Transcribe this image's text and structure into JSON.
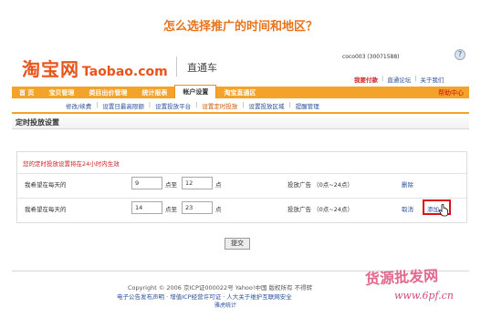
{
  "headline": "怎么选择推广的时间和地区？",
  "brand": {
    "logo_cn": "淘宝网",
    "logo_en": "Taobao.com",
    "product": "直通车",
    "accent_color": "#e8541a"
  },
  "account": {
    "user_text": "coco003 (30071588)"
  },
  "top_links": {
    "pay": "我要付款",
    "forum": "直通论坛",
    "about": "关于我们"
  },
  "nav": {
    "items": [
      "首 页",
      "宝贝管理",
      "类目出价管理",
      "统计报表",
      "帐户设置",
      "淘宝直通区"
    ],
    "active_index": 4,
    "help": "帮助中心",
    "bar_color": "#f3a22a"
  },
  "subnav": {
    "items": [
      "修改/续费",
      "设置日最高限额",
      "设置投放平台",
      "设置定时投放",
      "设置投放区域",
      "提醒管理"
    ],
    "current_index": 3
  },
  "section_title": "定时投放设置",
  "notice": "您的定时投放设置将在24小时内生效",
  "rows": [
    {
      "label": "我希望在每天的",
      "from": "9",
      "to_word": "点至",
      "to": "12",
      "unit": "点",
      "ads": "投放广告  （0点~24点）",
      "action": "删除"
    },
    {
      "label": "我希望在每天的",
      "from": "14",
      "to_word": "点至",
      "to": "23",
      "unit": "点",
      "ads": "投放广告  （0点~24点）",
      "action": "取消",
      "add": "添加"
    }
  ],
  "submit": "提交",
  "footer": {
    "copyright": "Copyright © 2006 京ICP证000022号  Yahoo!中国 版权所有  不得转",
    "links": "电子公告发布声明 · 增值ICP经营许可证 · 人大关于维护互联网安全",
    "stats": "雅虎统计"
  },
  "watermark": {
    "cn": "货源批发网",
    "url": "www.6pf.cn"
  }
}
